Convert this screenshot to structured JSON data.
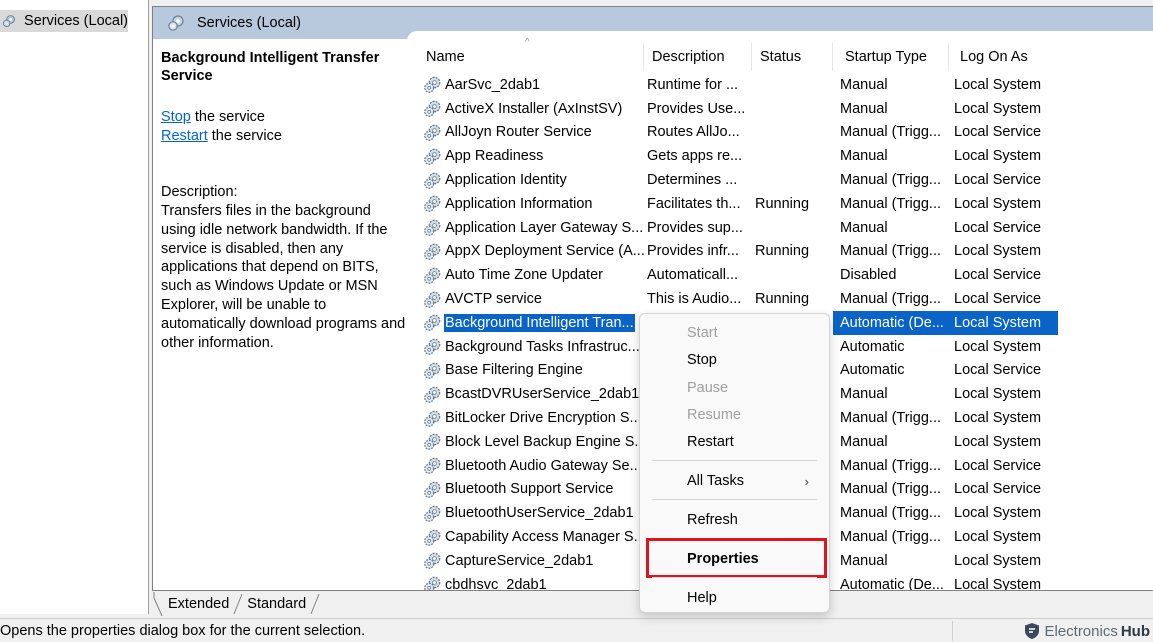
{
  "tree": {
    "root_label": "Services (Local)"
  },
  "panel_header": "Services (Local)",
  "details": {
    "service_name": "Background Intelligent Transfer Service",
    "stop_link": "Stop",
    "stop_suffix": " the service",
    "restart_link": "Restart",
    "restart_suffix": " the service",
    "description_label": "Description:",
    "description_text": "Transfers files in the background using idle network bandwidth. If the service is disabled, then any applications that depend on BITS, such as Windows Update or MSN Explorer, will be unable to automatically download programs and other information."
  },
  "columns": [
    "Name",
    "Description",
    "Status",
    "Startup Type",
    "Log On As"
  ],
  "rows": [
    {
      "name": "AarSvc_2dab1",
      "desc": "Runtime for ...",
      "status": "",
      "startup": "Manual",
      "logon": "Local System"
    },
    {
      "name": "ActiveX Installer (AxInstSV)",
      "desc": "Provides Use...",
      "status": "",
      "startup": "Manual",
      "logon": "Local System"
    },
    {
      "name": "AllJoyn Router Service",
      "desc": "Routes AllJo...",
      "status": "",
      "startup": "Manual (Trigg...",
      "logon": "Local Service"
    },
    {
      "name": "App Readiness",
      "desc": "Gets apps re...",
      "status": "",
      "startup": "Manual",
      "logon": "Local System"
    },
    {
      "name": "Application Identity",
      "desc": "Determines ...",
      "status": "",
      "startup": "Manual (Trigg...",
      "logon": "Local Service"
    },
    {
      "name": "Application Information",
      "desc": "Facilitates th...",
      "status": "Running",
      "startup": "Manual (Trigg...",
      "logon": "Local System"
    },
    {
      "name": "Application Layer Gateway S...",
      "desc": "Provides sup...",
      "status": "",
      "startup": "Manual",
      "logon": "Local Service"
    },
    {
      "name": "AppX Deployment Service (A...",
      "desc": "Provides infr...",
      "status": "Running",
      "startup": "Manual (Trigg...",
      "logon": "Local System"
    },
    {
      "name": "Auto Time Zone Updater",
      "desc": "Automaticall...",
      "status": "",
      "startup": "Disabled",
      "logon": "Local Service"
    },
    {
      "name": "AVCTP service",
      "desc": "This is Audio...",
      "status": "Running",
      "startup": "Manual (Trigg...",
      "logon": "Local Service"
    },
    {
      "name": "Background Intelligent Tran...",
      "desc": "",
      "status": "",
      "startup": "Automatic (De...",
      "logon": "Local System",
      "selected": true
    },
    {
      "name": "Background Tasks Infrastruc...",
      "desc": "",
      "status": "",
      "startup": "Automatic",
      "logon": "Local System"
    },
    {
      "name": "Base Filtering Engine",
      "desc": "",
      "status": "",
      "startup": "Automatic",
      "logon": "Local Service"
    },
    {
      "name": "BcastDVRUserService_2dab1",
      "desc": "",
      "status": "",
      "startup": "Manual",
      "logon": "Local System"
    },
    {
      "name": "BitLocker Drive Encryption S...",
      "desc": "",
      "status": "",
      "startup": "Manual (Trigg...",
      "logon": "Local System"
    },
    {
      "name": "Block Level Backup Engine S...",
      "desc": "",
      "status": "",
      "startup": "Manual",
      "logon": "Local System"
    },
    {
      "name": "Bluetooth Audio Gateway Se...",
      "desc": "",
      "status": "",
      "startup": "Manual (Trigg...",
      "logon": "Local Service"
    },
    {
      "name": "Bluetooth Support Service",
      "desc": "",
      "status": "",
      "startup": "Manual (Trigg...",
      "logon": "Local Service"
    },
    {
      "name": "BluetoothUserService_2dab1",
      "desc": "",
      "status": "",
      "startup": "Manual (Trigg...",
      "logon": "Local System"
    },
    {
      "name": "Capability Access Manager S...",
      "desc": "",
      "status": "",
      "startup": "Manual (Trigg...",
      "logon": "Local System"
    },
    {
      "name": "CaptureService_2dab1",
      "desc": "",
      "status": "",
      "startup": "Manual",
      "logon": "Local System"
    },
    {
      "name": "cbdhsvc_2dab1",
      "desc": "",
      "status": "",
      "startup": "Automatic (De...",
      "logon": "Local System"
    }
  ],
  "context_menu": {
    "start": "Start",
    "stop": "Stop",
    "pause": "Pause",
    "resume": "Resume",
    "restart": "Restart",
    "all_tasks": "All Tasks",
    "all_tasks_arrow": "›",
    "refresh": "Refresh",
    "properties": "Properties",
    "help": "Help"
  },
  "tabs": {
    "extended": "Extended",
    "standard": "Standard"
  },
  "statusbar": {
    "message": "Opens the properties dialog box for the current selection."
  },
  "brand": {
    "prefix": "Electronics",
    "suffix": "Hub"
  },
  "colors": {
    "selection": "#0a64c8",
    "highlight_box": "#e0141e",
    "header_band": "#b9c9dd",
    "link": "#0066cc"
  },
  "icons": {
    "service": "service-gear-icon",
    "tree": "services-gear-icon",
    "brand": "shield-logo-icon"
  }
}
